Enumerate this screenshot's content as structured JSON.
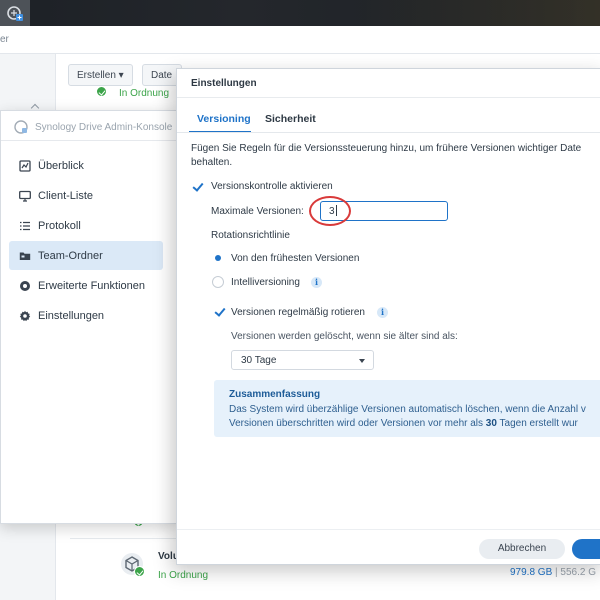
{
  "taskbar": {
    "app_icon": "synology-drive-icon"
  },
  "background_window": {
    "title_fragment": "er",
    "toolbar": {
      "create_label": "Erstellen ▾",
      "date_label": "Date"
    },
    "row1": {
      "status": "In Ordnung"
    },
    "row2": {
      "status": "In Ordnung"
    },
    "row3": {
      "name": "Volu",
      "status": "In Ordnung",
      "used": "979.8 GB",
      "separator": " | ",
      "total": "556.2 G"
    }
  },
  "admin_console": {
    "title": "Synology Drive Admin-Konsole",
    "nav": [
      {
        "label": "Überblick",
        "icon": "overview-icon",
        "active": false
      },
      {
        "label": "Client-Liste",
        "icon": "monitor-icon",
        "active": false
      },
      {
        "label": "Protokoll",
        "icon": "list-icon",
        "active": false
      },
      {
        "label": "Team-Ordner",
        "icon": "folder-icon",
        "active": true
      },
      {
        "label": "Erweiterte Funktionen",
        "icon": "advanced-icon",
        "active": false
      },
      {
        "label": "Einstellungen",
        "icon": "gear-icon",
        "active": false
      }
    ]
  },
  "dialog": {
    "title": "Einstellungen",
    "tabs": [
      {
        "label": "Versioning",
        "active": true
      },
      {
        "label": "Sicherheit",
        "active": false
      }
    ],
    "description_line1": "Fügen Sie Regeln für die Versionssteuerung hinzu, um frühere Versionen wichtiger Date",
    "description_line2": "behalten.",
    "enable_versioning": {
      "label": "Versionskontrolle aktivieren",
      "checked": true
    },
    "max_versions": {
      "label": "Maximale Versionen:",
      "value": "3"
    },
    "rotation_label": "Rotationsrichtlinie",
    "rotation_options": [
      {
        "label": "Von den frühesten Versionen",
        "selected": true
      },
      {
        "label": "Intelliversioning",
        "selected": false
      }
    ],
    "rotate_regularly": {
      "label": "Versionen regelmäßig rotieren",
      "checked": true
    },
    "delete_older_label": "Versionen werden gelöscht, wenn sie älter sind als:",
    "age_select": {
      "value": "30 Tage"
    },
    "summary": {
      "title": "Zusammenfassung",
      "line1": "Das System wird überzählige Versionen automatisch löschen, wenn die Anzahl v",
      "line2_a": "Versionen überschritten wird oder Versionen vor mehr als ",
      "line2_b": "30",
      "line2_c": " Tagen erstellt wur"
    },
    "buttons": {
      "cancel": "Abbrechen",
      "ok": ""
    }
  },
  "colors": {
    "accent": "#1f73c8",
    "success": "#3ca44a",
    "highlight_circle": "#d93a3a"
  }
}
